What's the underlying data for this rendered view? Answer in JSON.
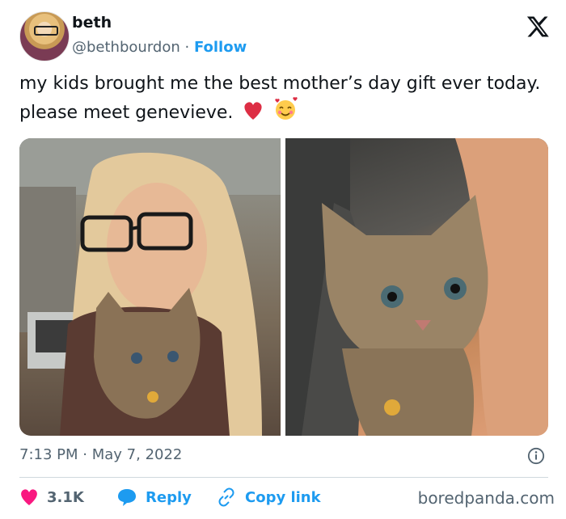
{
  "author": {
    "display_name": "beth",
    "handle": "@bethbourdon",
    "separator": "·",
    "follow_label": "Follow"
  },
  "tweet": {
    "text": "my kids brought me the best mother’s day gift ever today. please meet genevieve.",
    "time": "7:13 PM",
    "date_separator": "·",
    "date": "May 7, 2022"
  },
  "actions": {
    "likes": "3.1K",
    "reply_label": "Reply",
    "copy_link_label": "Copy link"
  },
  "source_watermark": "boredpanda.com",
  "icons": {
    "brand": "x-logo-icon",
    "like": "heart-icon",
    "reply": "speech-bubble-icon",
    "copy": "link-icon",
    "info": "info-icon"
  },
  "colors": {
    "link_blue": "#1d9bf0",
    "like_red": "#f91880",
    "muted_text": "#536471",
    "text": "#0f1419"
  }
}
